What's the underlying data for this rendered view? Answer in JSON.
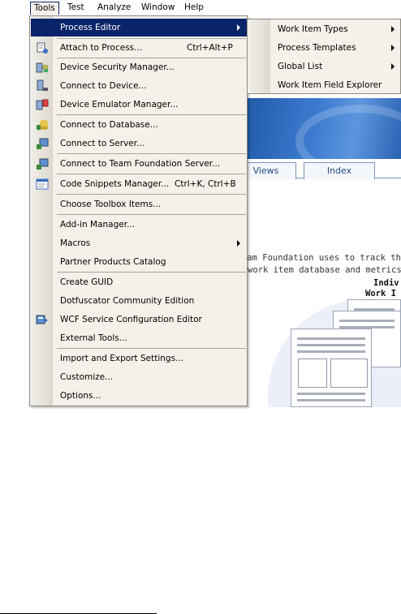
{
  "menubar": {
    "items": [
      "Tools",
      "Test",
      "Analyze",
      "Window",
      "Help"
    ],
    "active": "Tools"
  },
  "tools_menu": {
    "items": [
      {
        "label": "Process Editor",
        "shortcut": "",
        "submenu": true,
        "highlighted": true,
        "icon": ""
      },
      {
        "label": "Attach to Process...",
        "shortcut": "Ctrl+Alt+P",
        "icon": "attach-process-icon"
      },
      {
        "label": "Device Security Manager...",
        "shortcut": "",
        "icon": "device-security-icon"
      },
      {
        "label": "Connect to Device...",
        "shortcut": "",
        "icon": "connect-device-icon"
      },
      {
        "label": "Device Emulator Manager...",
        "shortcut": "",
        "icon": "device-emulator-icon"
      },
      {
        "label": "Connect to Database...",
        "shortcut": "",
        "icon": "connect-database-icon"
      },
      {
        "label": "Connect to Server...",
        "shortcut": "",
        "icon": "connect-server-icon"
      },
      {
        "label": "Connect to Team Foundation Server...",
        "shortcut": "",
        "icon": "team-foundation-server-icon"
      },
      {
        "label": "Code Snippets Manager...",
        "shortcut": "Ctrl+K, Ctrl+B",
        "icon": "code-snippets-icon"
      },
      {
        "label": "Choose Toolbox Items...",
        "shortcut": "",
        "icon": ""
      },
      {
        "label": "Add-in Manager...",
        "shortcut": "",
        "icon": ""
      },
      {
        "label": "Macros",
        "shortcut": "",
        "submenu": true,
        "icon": ""
      },
      {
        "label": "Partner Products Catalog",
        "shortcut": "",
        "icon": ""
      },
      {
        "label": "Create GUID",
        "shortcut": "",
        "icon": ""
      },
      {
        "label": "Dotfuscator Community Edition",
        "shortcut": "",
        "icon": ""
      },
      {
        "label": "WCF Service Configuration Editor",
        "shortcut": "",
        "icon": "wcf-config-icon"
      },
      {
        "label": "External Tools...",
        "shortcut": "",
        "icon": ""
      },
      {
        "label": "Import and Export Settings...",
        "shortcut": "",
        "icon": ""
      },
      {
        "label": "Customize...",
        "shortcut": "",
        "icon": ""
      },
      {
        "label": "Options...",
        "shortcut": "",
        "icon": ""
      }
    ]
  },
  "process_editor_submenu": {
    "items": [
      {
        "label": "Work Item Types",
        "submenu": true
      },
      {
        "label": "Process Templates",
        "submenu": true
      },
      {
        "label": "Global List",
        "submenu": true
      },
      {
        "label": "Work Item Field Explorer",
        "submenu": false
      }
    ]
  },
  "background": {
    "tabs": [
      "Views",
      "Index"
    ],
    "text_line1": "eam Foundation uses to track the",
    "text_line2": "work item database and metrics",
    "heading_line1": "Indiv",
    "heading_line2": "Work I"
  },
  "colors": {
    "highlight": "#0a246a",
    "menu_bg": "#f5f1ea",
    "banner": "#2a62b3"
  }
}
